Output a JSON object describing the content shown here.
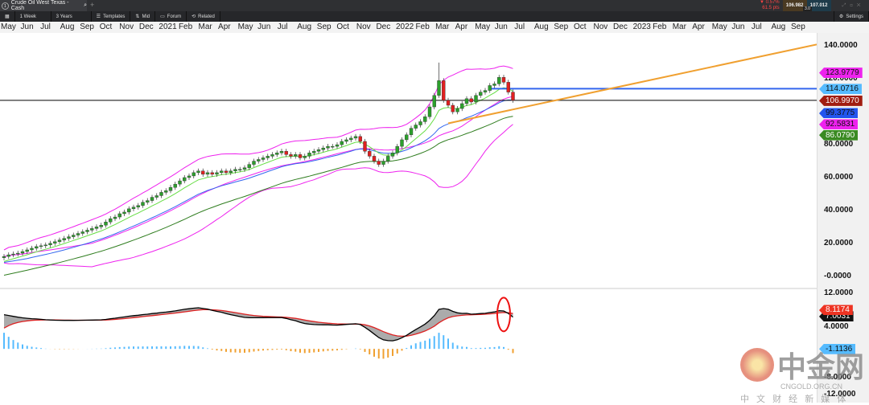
{
  "window": {
    "tab_number": "1",
    "title": "Crude Oil West Texas - Cash",
    "add_tab": "+"
  },
  "quote": {
    "change_pct": "▼ 0.57%",
    "change_pts": "61.5 pts",
    "bid": "106.982",
    "ask": "107.012",
    "spread": "3.0"
  },
  "toolbar": {
    "interval": "1 Week",
    "range": "3 Years",
    "templates": "Templates",
    "mid": "Mid",
    "forum": "Forum",
    "related": "Related",
    "settings": "Settings"
  },
  "colors": {
    "bull": "#2ca02c",
    "bear": "#e02020",
    "ma_fast": "#66dd44",
    "ma_mid": "#3366ee",
    "ma_slow": "#2f7d1f",
    "bollinger": "#ee22ee",
    "trendline": "#f0a030",
    "hline": "#3366ee",
    "macd_line": "#000000",
    "signal_line": "#dd2222",
    "hist_pos": "#55bbff",
    "hist_neg": "#f0a030"
  },
  "chart_data": {
    "type": "candlestick",
    "interval": "weekly",
    "x_tick_labels": [
      "May",
      "Jun",
      "Jul",
      "Aug",
      "Sep",
      "Oct",
      "Nov",
      "Dec",
      "2021",
      "Feb",
      "Mar",
      "Apr",
      "May",
      "Jun",
      "Jul",
      "Aug",
      "Sep",
      "Oct",
      "Nov",
      "Dec",
      "2022",
      "Feb",
      "Mar",
      "Apr",
      "May",
      "Jun",
      "Jul",
      "Aug",
      "Sep",
      "Oct",
      "Nov",
      "Dec",
      "2023",
      "Feb",
      "Mar",
      "Apr",
      "May",
      "Jun",
      "Jul",
      "Aug",
      "Sep"
    ],
    "y_ticks": [
      "140.0000",
      "120.0000",
      "80.0000",
      "60.0000",
      "40.0000",
      "20.0000",
      "-0.0000"
    ],
    "y_tick_values": [
      140,
      120,
      80,
      60,
      40,
      20,
      0
    ],
    "ylim": [
      -7,
      148
    ],
    "closes": [
      12,
      13,
      13.5,
      14,
      15,
      16,
      17,
      18,
      18.5,
      19,
      20,
      21,
      22,
      23,
      24,
      25,
      26,
      27,
      28,
      29,
      30,
      31,
      33,
      35,
      36,
      38,
      39,
      41,
      42,
      43,
      45,
      46,
      48,
      49,
      51,
      52,
      54,
      56,
      58,
      60,
      61,
      63,
      64,
      62,
      63,
      62,
      63,
      64,
      63,
      64,
      65,
      65,
      66,
      68,
      70,
      71,
      72,
      73,
      74,
      75,
      76,
      74,
      73,
      74,
      72,
      73,
      75,
      76,
      77,
      78,
      79,
      79,
      80,
      82,
      83,
      84,
      85,
      82,
      76,
      73,
      70,
      68,
      70,
      73,
      75,
      79,
      83,
      86,
      90,
      92,
      94,
      97,
      103,
      110,
      119,
      107,
      104,
      100,
      102,
      105,
      108,
      106,
      110,
      112,
      113,
      116,
      117,
      121,
      118,
      112,
      107
    ],
    "price_tags": [
      {
        "label": "123.9779",
        "value": 123.9779,
        "color": "#ee22ee",
        "text": "#111"
      },
      {
        "label": "114.0716",
        "value": 114.0716,
        "color": "#55bbff",
        "text": "#111"
      },
      {
        "label": "106.9970",
        "value": 106.997,
        "color": "#a01c10",
        "text": "#fff"
      },
      {
        "label": "99.3775",
        "value": 99.3775,
        "color": "#2255ee",
        "text": "#111"
      },
      {
        "label": "92.5831",
        "value": 92.5831,
        "color": "#ee22ee",
        "text": "#111"
      },
      {
        "label": "86.0790",
        "value": 86.079,
        "color": "#3a8a22",
        "text": "#fff"
      }
    ],
    "horizontal_lines": [
      {
        "value": 106.997,
        "color": "#000000"
      },
      {
        "value": 114.0716,
        "color": "#3366ee"
      }
    ],
    "trendline": {
      "from": {
        "week": 96,
        "value": 93
      },
      "to_value_at_right_edge": 141
    },
    "macd": {
      "y_ticks": [
        "12.0000",
        "4.0000",
        "-8.0000",
        "-12.0000"
      ],
      "y_tick_values": [
        12,
        4,
        -8,
        -12
      ],
      "ylim": [
        -14,
        13
      ],
      "tags": [
        {
          "label": "8.1174",
          "value": 8.1174,
          "color": "#ee3322",
          "text": "#fff"
        },
        {
          "label": "7.0031",
          "value": 6.6,
          "color": "#111",
          "text": "#fff"
        },
        {
          "label": "-1.1136",
          "value": -1.1136,
          "color": "#55bbff",
          "text": "#111"
        }
      ]
    }
  },
  "watermark": {
    "logo": "中金网",
    "domain": "CNGOLD.ORG.CN",
    "slogan": "中 文 财 经 新 媒 体"
  }
}
